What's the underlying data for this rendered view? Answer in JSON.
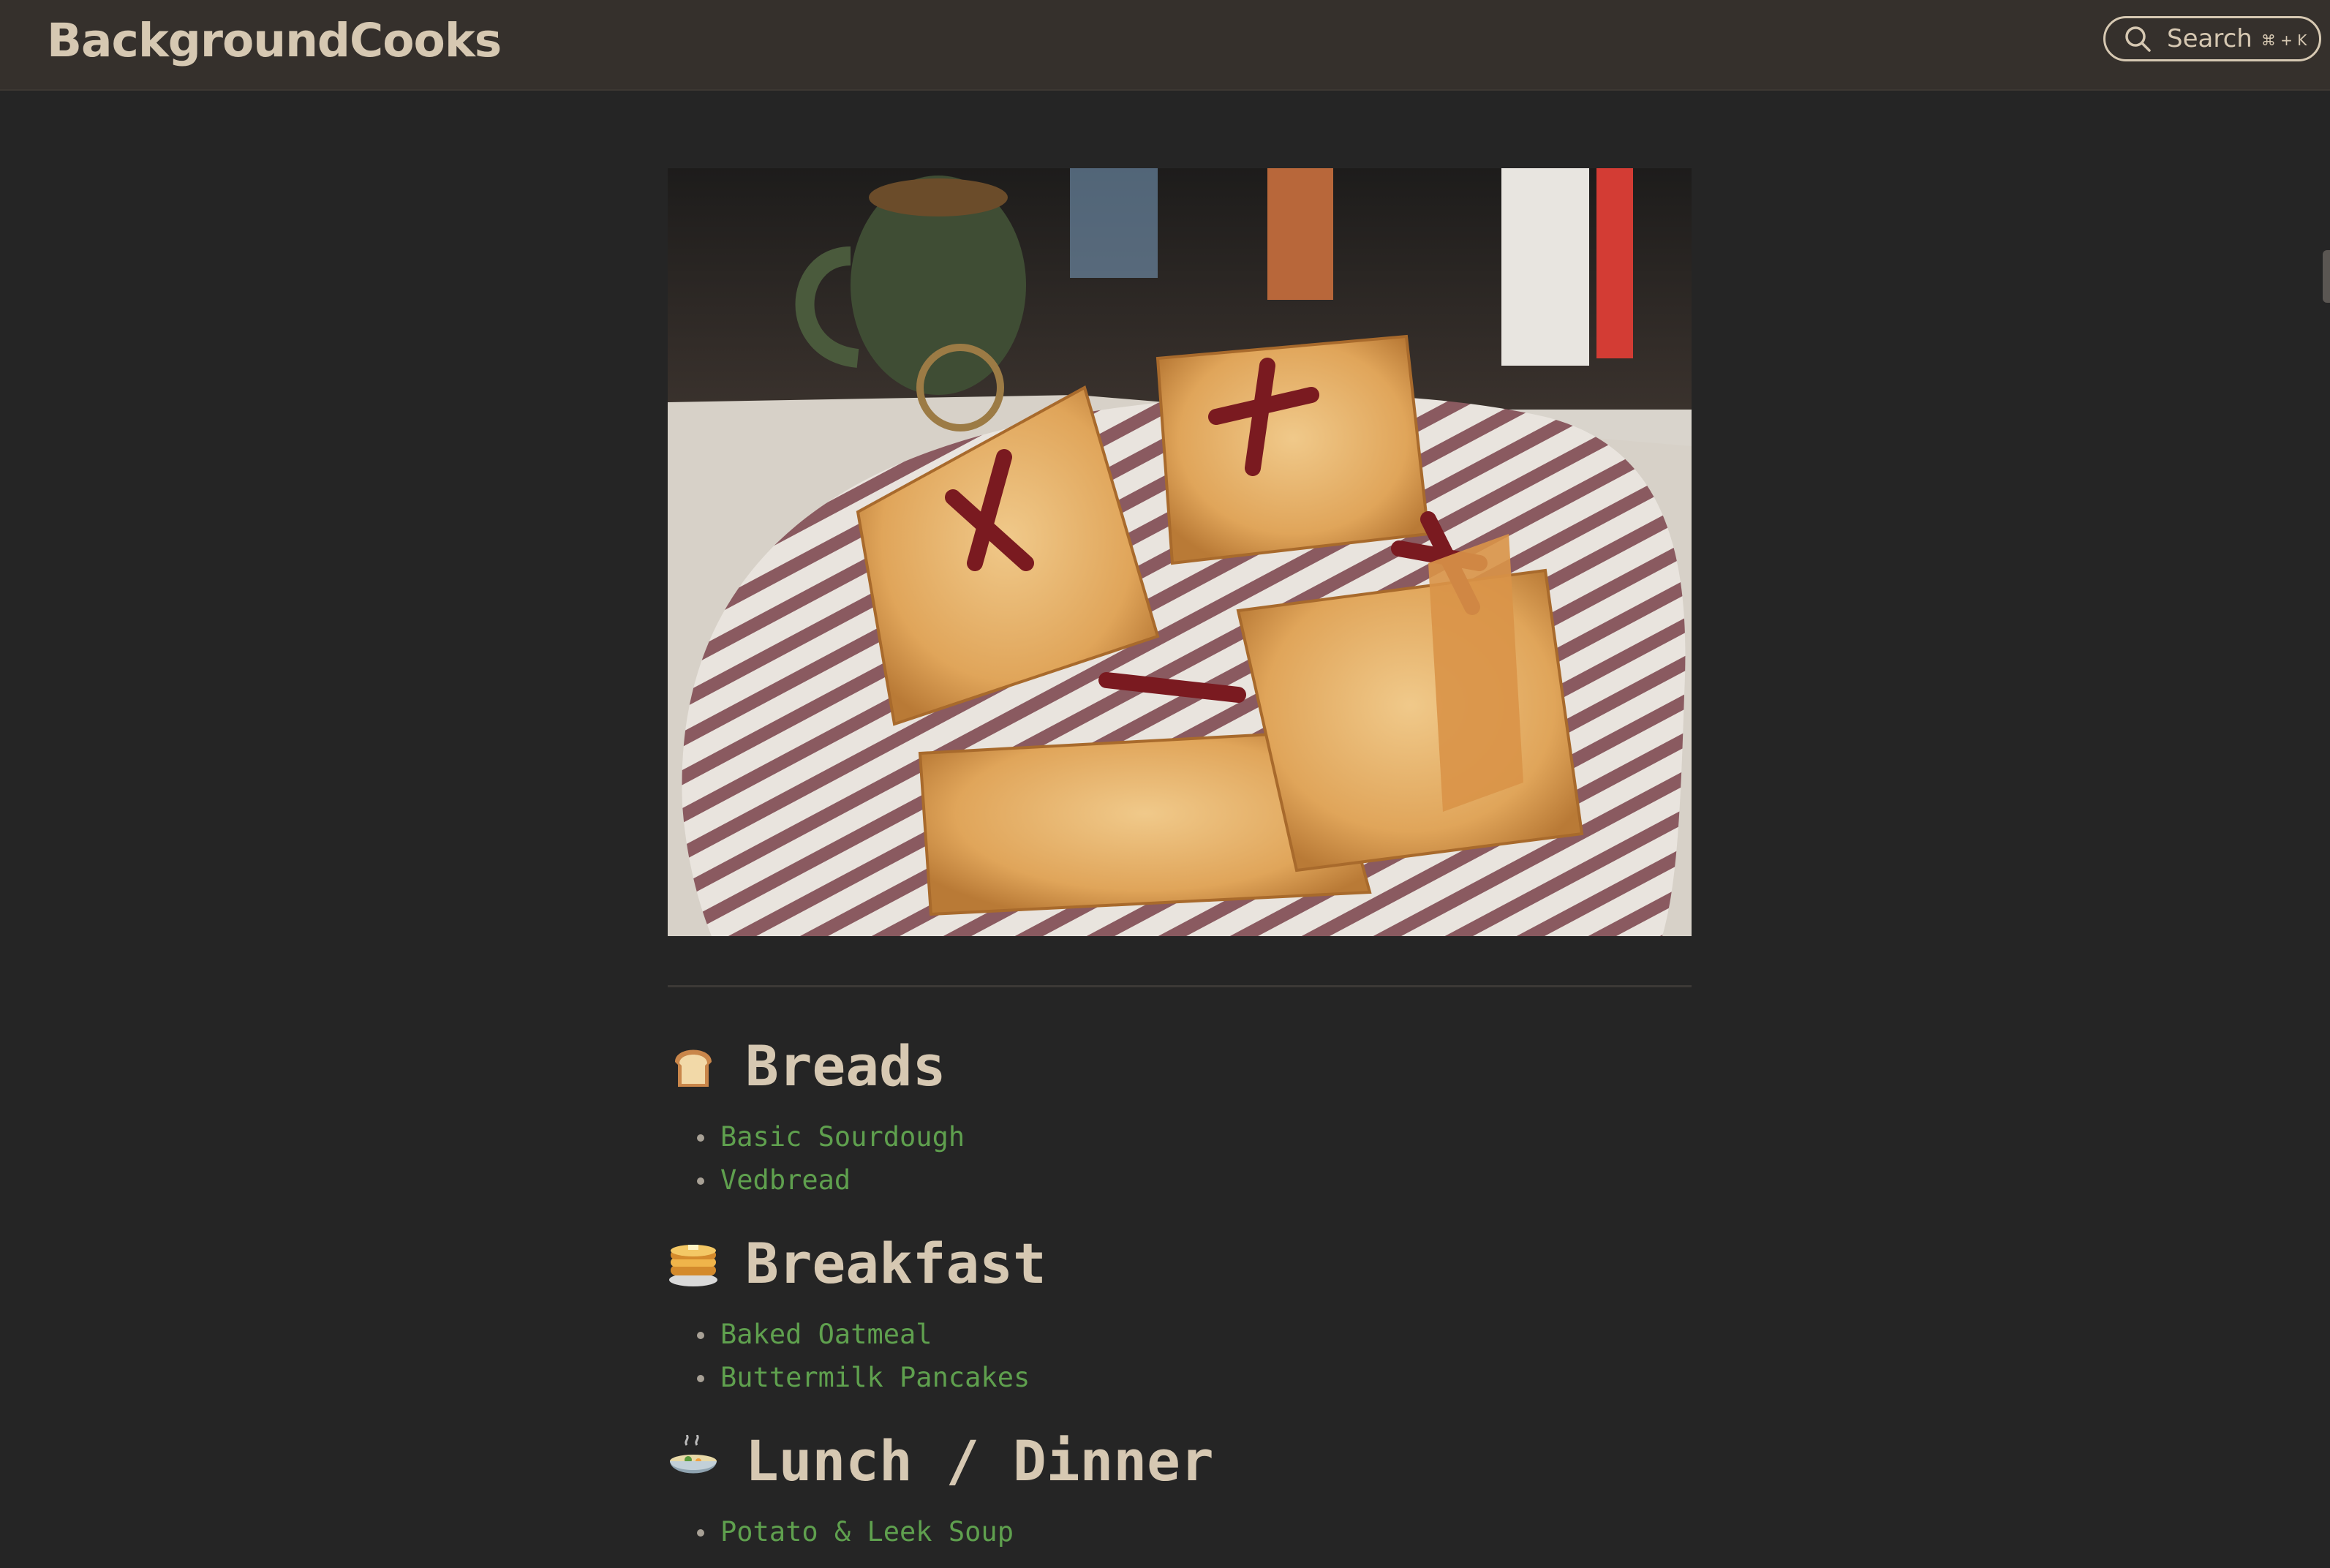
{
  "header": {
    "site_title": "BackgroundCooks",
    "search": {
      "label": "Search",
      "shortcut": "⌘ + K",
      "icon": "search-icon"
    }
  },
  "hero": {
    "icon": "hero-photo-icon"
  },
  "sections": [
    {
      "emoji": "bread-icon",
      "title": "Breads",
      "items": [
        "Basic Sourdough",
        "Vedbread"
      ]
    },
    {
      "emoji": "pancakes-icon",
      "title": "Breakfast",
      "items": [
        "Baked Oatmeal",
        "Buttermilk Pancakes"
      ]
    },
    {
      "emoji": "soup-bowl-icon",
      "title": "Lunch / Dinner",
      "items": [
        "Potato & Leek Soup"
      ]
    }
  ],
  "colors": {
    "background": "#252525",
    "header_background": "#35302c",
    "heading_text": "#d6c8b2",
    "link": "#5fa04e"
  }
}
